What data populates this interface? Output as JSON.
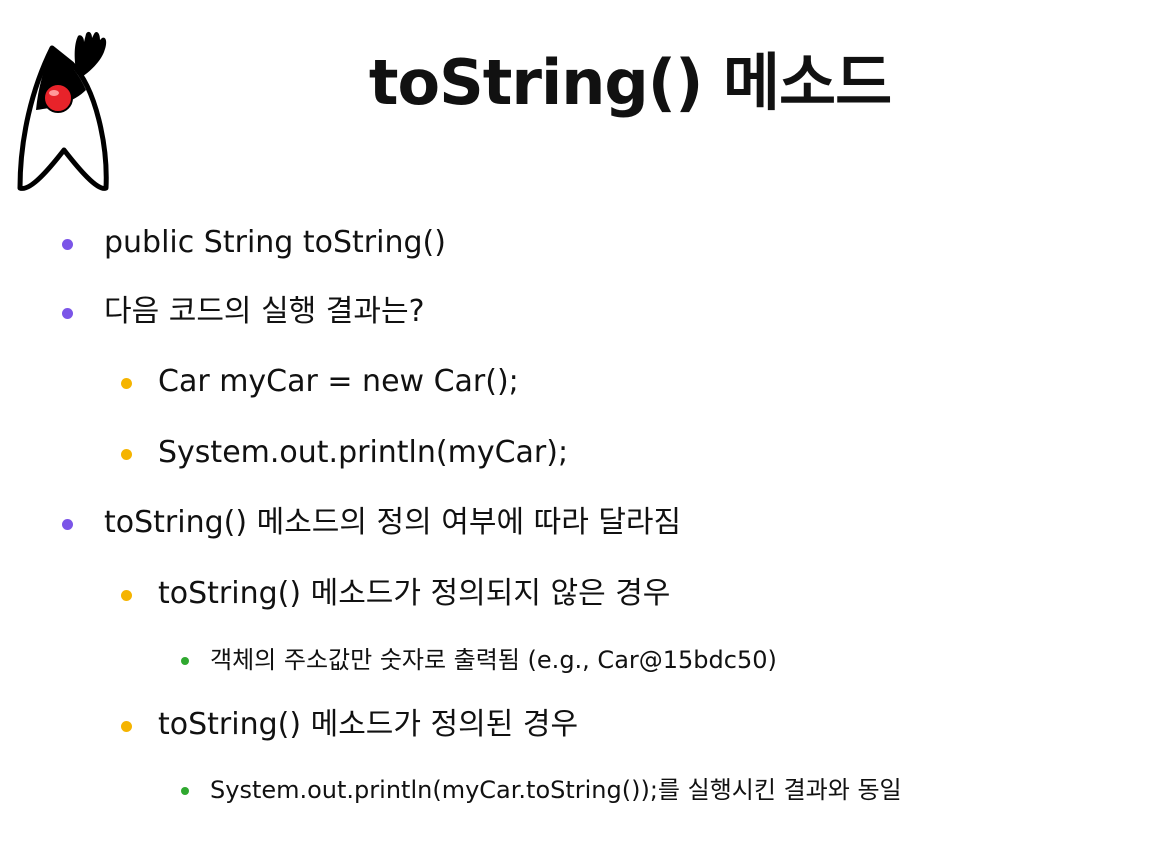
{
  "slide": {
    "title": "toString() 메소드",
    "bullets": [
      {
        "text": "public String toString()"
      },
      {
        "text": "다음 코드의 실행 결과는?"
      },
      {
        "text": "Car myCar = new Car();"
      },
      {
        "text": "System.out.println(myCar);"
      },
      {
        "text": "toString() 메소드의 정의 여부에 따라 달라짐"
      },
      {
        "text": "toString() 메소드가 정의되지 않은 경우"
      },
      {
        "text": "객체의 주소값만 숫자로 출력됨 (e.g., Car@15bdc50)"
      },
      {
        "text": "toString() 메소드가 정의된 경우"
      },
      {
        "text": "System.out.println(myCar.toString());를 실행시킨 결과와 동일"
      }
    ]
  },
  "colors": {
    "level1_bullet": "#7b55e8",
    "level2_bullet": "#f5b400",
    "level3_bullet": "#2fa82f",
    "mascot_nose": "#e8232a"
  },
  "icons": {
    "mascot": "java-duke-mascot-icon"
  }
}
